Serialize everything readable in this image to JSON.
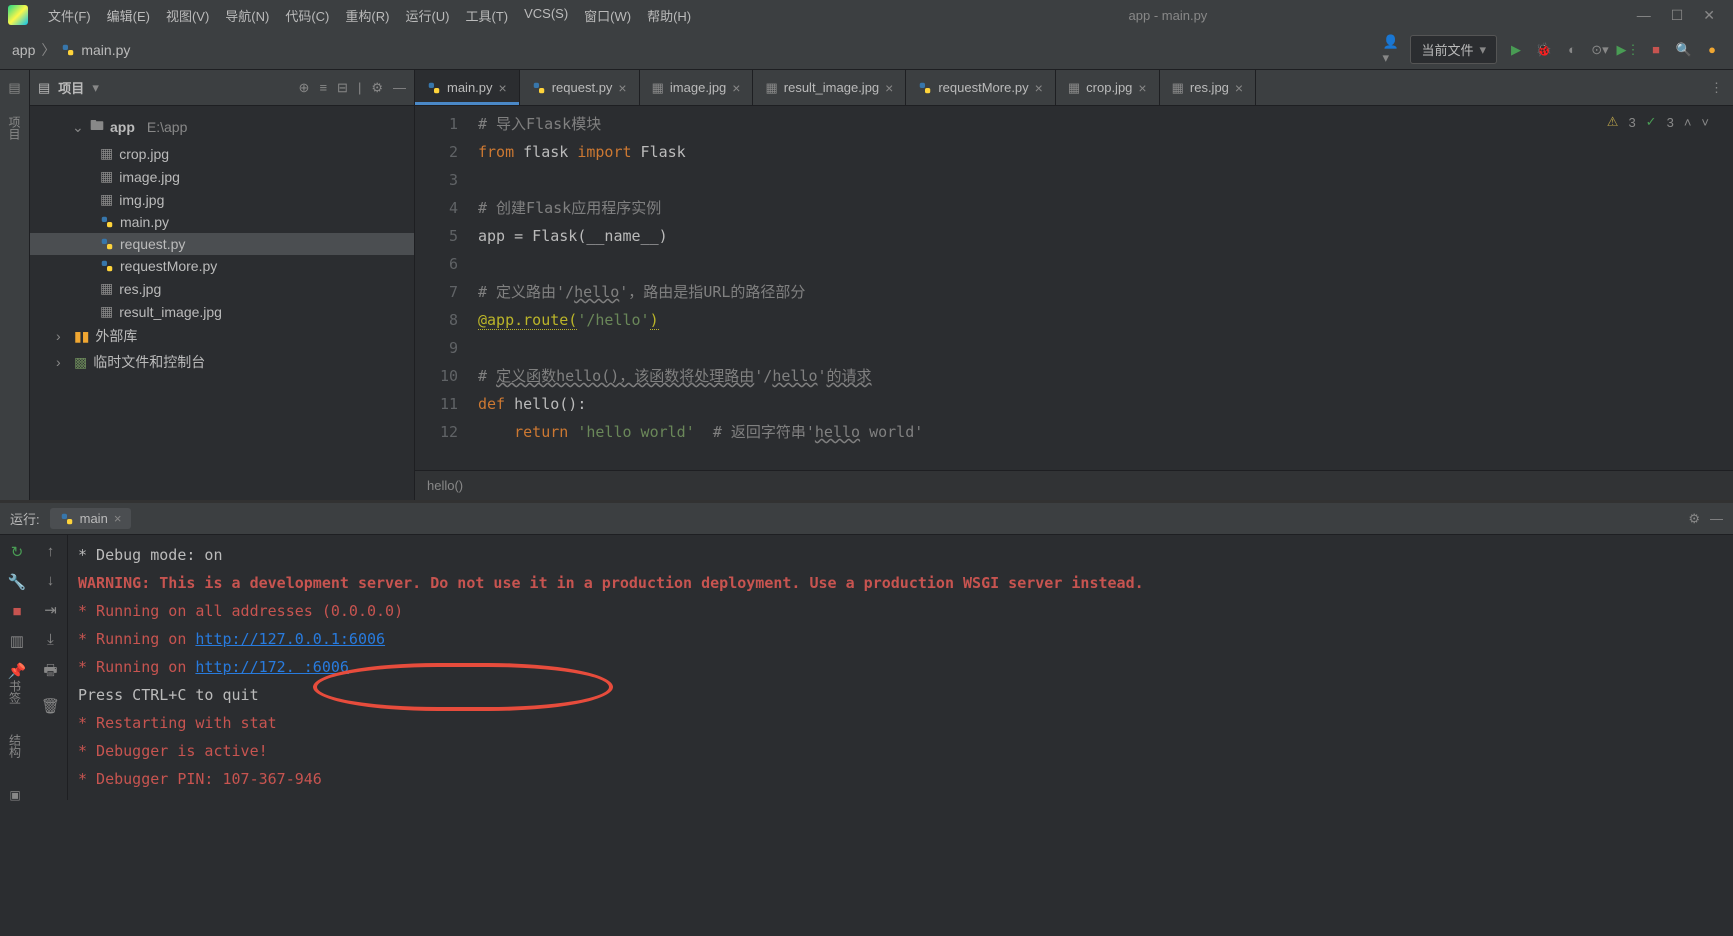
{
  "titlebar": {
    "menus": [
      "文件(F)",
      "编辑(E)",
      "视图(V)",
      "导航(N)",
      "代码(C)",
      "重构(R)",
      "运行(U)",
      "工具(T)",
      "VCS(S)",
      "窗口(W)",
      "帮助(H)"
    ],
    "title": "app - main.py"
  },
  "breadcrumb": {
    "root": "app",
    "file": "main.py"
  },
  "run_config": "当前文件",
  "project": {
    "panel_title": "项目",
    "root": {
      "name": "app",
      "path": "E:\\app"
    },
    "files": [
      "crop.jpg",
      "image.jpg",
      "img.jpg",
      "main.py",
      "request.py",
      "requestMore.py",
      "res.jpg",
      "result_image.jpg"
    ],
    "external_libs": "外部库",
    "scratches": "临时文件和控制台"
  },
  "tabs": [
    {
      "name": "main.py",
      "active": true,
      "icon": "py"
    },
    {
      "name": "request.py",
      "active": false,
      "icon": "py"
    },
    {
      "name": "image.jpg",
      "active": false,
      "icon": "img"
    },
    {
      "name": "result_image.jpg",
      "active": false,
      "icon": "img"
    },
    {
      "name": "requestMore.py",
      "active": false,
      "icon": "py"
    },
    {
      "name": "crop.jpg",
      "active": false,
      "icon": "img"
    },
    {
      "name": "res.jpg",
      "active": false,
      "icon": "img"
    }
  ],
  "editor_status": {
    "warnings": "3",
    "checks": "3"
  },
  "code_lines": [
    {
      "n": 1,
      "html": "<span class='c-comment'># 导入Flask模块</span>"
    },
    {
      "n": 2,
      "html": "<span class='c-keyword'>from</span> flask <span class='c-keyword'>import</span> Flask"
    },
    {
      "n": 3,
      "html": ""
    },
    {
      "n": 4,
      "html": "<span class='c-comment'># 创建Flask应用程序实例</span>"
    },
    {
      "n": 5,
      "html": "app = Flask(__name__)"
    },
    {
      "n": 6,
      "html": ""
    },
    {
      "n": 7,
      "html": "<span class='c-comment'># 定义路由'/<span class='c-wavy'>hello</span>'，路由是指URL的路径部分</span>"
    },
    {
      "n": 8,
      "html": "<span class='c-decorator'>@app.route(</span><span class='c-string'>'/hello'</span><span class='c-decorator'>)</span>"
    },
    {
      "n": 9,
      "html": ""
    },
    {
      "n": 10,
      "html": "<span class='c-comment'># <span class='c-wavy'>定义函数hello()，该函数将处理路由</span>'/<span class='c-wavy'>hello</span>'<span class='c-wavy'>的请求</span></span>"
    },
    {
      "n": 11,
      "html": "<span class='c-keyword'>def </span>hello():"
    },
    {
      "n": 12,
      "html": "    <span class='c-keyword'>return</span> <span class='c-string'>'hello world'</span>  <span class='c-comment'># 返回字符串'<span class='c-wavy'>hello</span> world'</span>"
    }
  ],
  "breadcrumb_fn": "hello()",
  "run": {
    "label": "运行:",
    "tab": "main",
    "output": [
      {
        "cls": "run-normal",
        "text": " * Debug mode: on"
      },
      {
        "cls": "run-warn",
        "text": "WARNING: This is a development server. Do not use it in a production deployment. Use a production WSGI server instead."
      },
      {
        "cls": "run-star",
        "text": " * Running on all addresses (0.0.0.0)"
      },
      {
        "cls": "run-star",
        "html": " * Running on <span class='run-link'>http://127.0.0.1:6006</span>"
      },
      {
        "cls": "run-star",
        "html": " * Running on <span class='run-link'>http://172.       :6006</span>"
      },
      {
        "cls": "run-normal",
        "text": "Press CTRL+C to quit"
      },
      {
        "cls": "run-star",
        "text": " * Restarting with stat"
      },
      {
        "cls": "run-star",
        "text": " * Debugger is active!"
      },
      {
        "cls": "run-star",
        "text": " * Debugger PIN: 107-367-946"
      }
    ]
  },
  "left_tools": [
    "项目"
  ],
  "bottom_tools": [
    "书签",
    "结构"
  ]
}
